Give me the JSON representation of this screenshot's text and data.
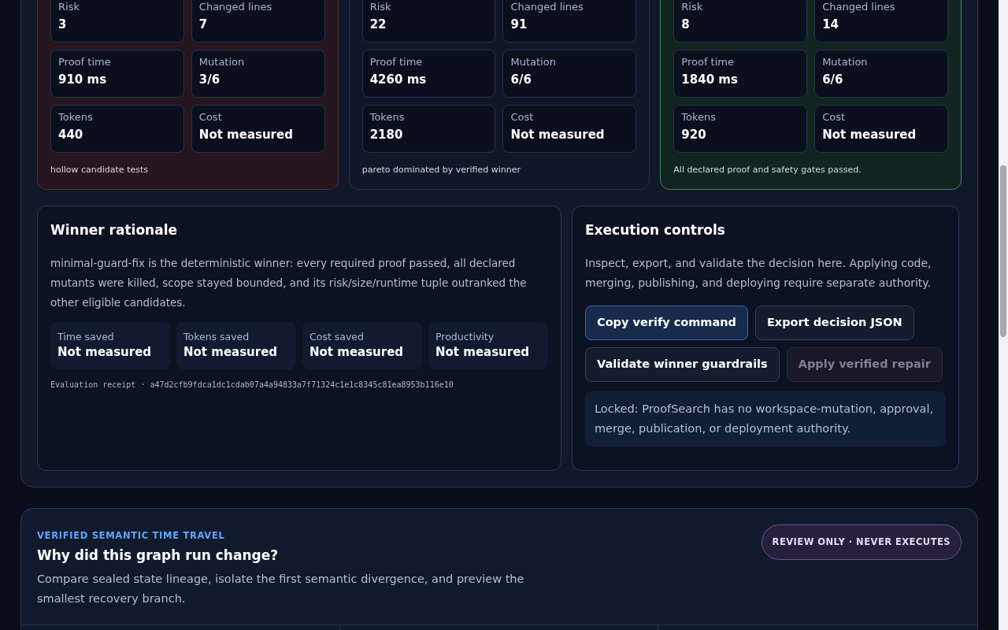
{
  "candidates": [
    {
      "kind": "rejected",
      "metrics": [
        {
          "label": "Risk",
          "value": "3"
        },
        {
          "label": "Changed lines",
          "value": "7"
        },
        {
          "label": "Proof time",
          "value": "910 ms"
        },
        {
          "label": "Mutation",
          "value": "3/6"
        },
        {
          "label": "Tokens",
          "value": "440"
        },
        {
          "label": "Cost",
          "value": "Not measured"
        }
      ],
      "note": "hollow candidate tests"
    },
    {
      "kind": "dominated",
      "metrics": [
        {
          "label": "Risk",
          "value": "22"
        },
        {
          "label": "Changed lines",
          "value": "91"
        },
        {
          "label": "Proof time",
          "value": "4260 ms"
        },
        {
          "label": "Mutation",
          "value": "6/6"
        },
        {
          "label": "Tokens",
          "value": "2180"
        },
        {
          "label": "Cost",
          "value": "Not measured"
        }
      ],
      "note": "pareto dominated by verified winner"
    },
    {
      "kind": "winner",
      "metrics": [
        {
          "label": "Risk",
          "value": "8"
        },
        {
          "label": "Changed lines",
          "value": "14"
        },
        {
          "label": "Proof time",
          "value": "1840 ms"
        },
        {
          "label": "Mutation",
          "value": "6/6"
        },
        {
          "label": "Tokens",
          "value": "920"
        },
        {
          "label": "Cost",
          "value": "Not measured"
        }
      ],
      "note": "All declared proof and safety gates passed."
    }
  ],
  "rationale": {
    "title": "Winner rationale",
    "text": "minimal-guard-fix is the deterministic winner: every required proof passed, all declared mutants were killed, scope stayed bounded, and its risk/size/runtime tuple outranked the other eligible candidates.",
    "savings": [
      {
        "label": "Time saved",
        "value": "Not measured"
      },
      {
        "label": "Tokens saved",
        "value": "Not measured"
      },
      {
        "label": "Cost saved",
        "value": "Not measured"
      },
      {
        "label": "Productivity",
        "value": "Not measured"
      }
    ],
    "receipt": "Evaluation receipt · a47d2cfb9fdca1dc1cdab07a4a94833a7f71324c1e1c8345c81ea8953b116e10"
  },
  "controls": {
    "title": "Execution controls",
    "text": "Inspect, export, and validate the decision here. Applying code, merging, publishing, and deploying require separate authority.",
    "buttons": [
      {
        "label": "Copy verify command",
        "kind": "primary",
        "disabled": false
      },
      {
        "label": "Export decision JSON",
        "kind": "secondary",
        "disabled": false
      },
      {
        "label": "Validate winner guardrails",
        "kind": "secondary",
        "disabled": false
      },
      {
        "label": "Apply verified repair",
        "kind": "secondary",
        "disabled": true
      }
    ],
    "locked_note": "Locked: ProofSearch has no workspace-mutation, approval, merge, publication, or deployment authority."
  },
  "time_travel": {
    "eyebrow": "VERIFIED SEMANTIC TIME TRAVEL",
    "title": "Why did this graph run change?",
    "text": "Compare sealed state lineage, isolate the first semantic divergence, and preview the smallest recovery branch.",
    "badge": "REVIEW ONLY · NEVER EXECUTES"
  }
}
